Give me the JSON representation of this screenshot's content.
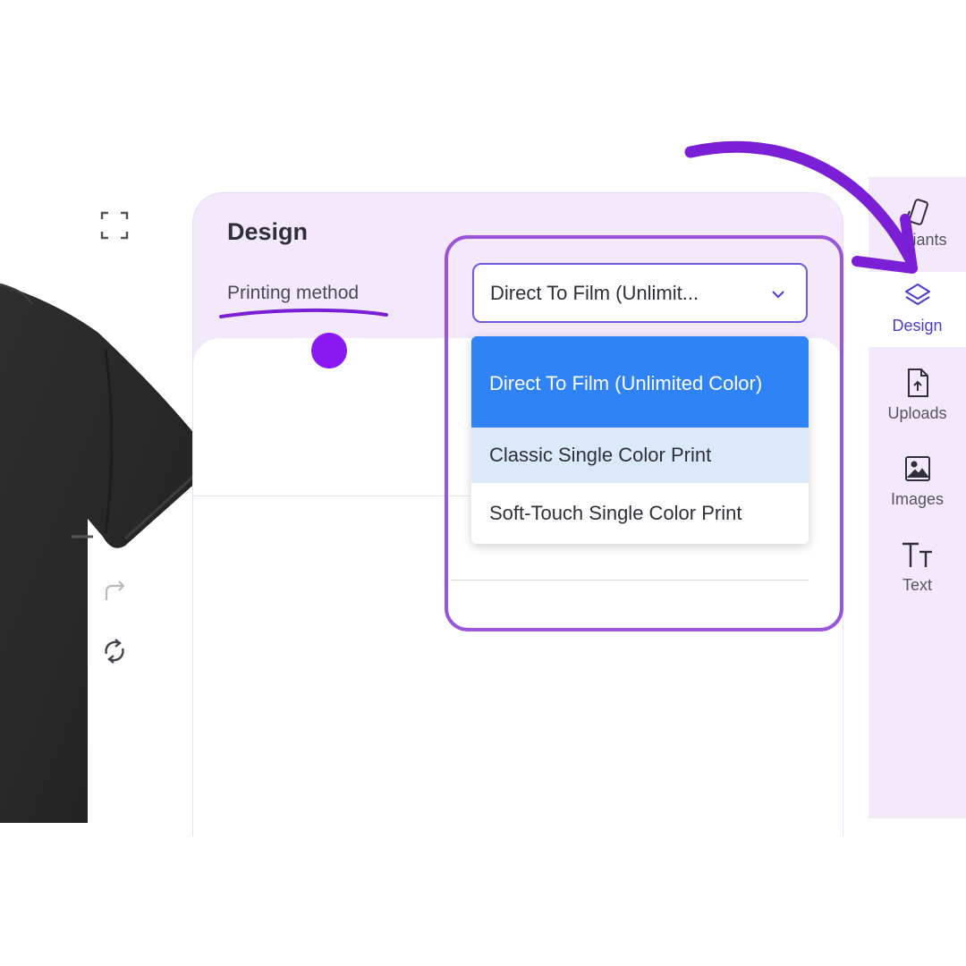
{
  "panel": {
    "title": "Design",
    "printing_method_label": "Printing method"
  },
  "select": {
    "value": "Direct To Film (Unlimit...",
    "options": [
      "Direct To Film (Unlimited Color)",
      "Classic Single Color Print",
      "Soft-Touch Single Color Print"
    ],
    "selected_index": 0,
    "hovered_index": 1
  },
  "sidebar": {
    "items": [
      {
        "label": "Variants",
        "visible_label": "riants",
        "icon": "phone-case-icon"
      },
      {
        "label": "Design",
        "icon": "layers-icon",
        "active": true
      },
      {
        "label": "Uploads",
        "icon": "upload-file-icon"
      },
      {
        "label": "Images",
        "icon": "image-icon"
      },
      {
        "label": "Text",
        "icon": "text-icon"
      }
    ]
  },
  "tools": [
    "fullscreen-icon",
    "redo-icon",
    "refresh-icon"
  ],
  "colors": {
    "accent_purple": "#7a1fd6",
    "highlight_frame": "#9a55d9",
    "panel_bg": "#f3e9fb",
    "option_selected": "#2f83f7",
    "option_hover": "#dce9fb",
    "shirt": "#2a2a2a"
  }
}
